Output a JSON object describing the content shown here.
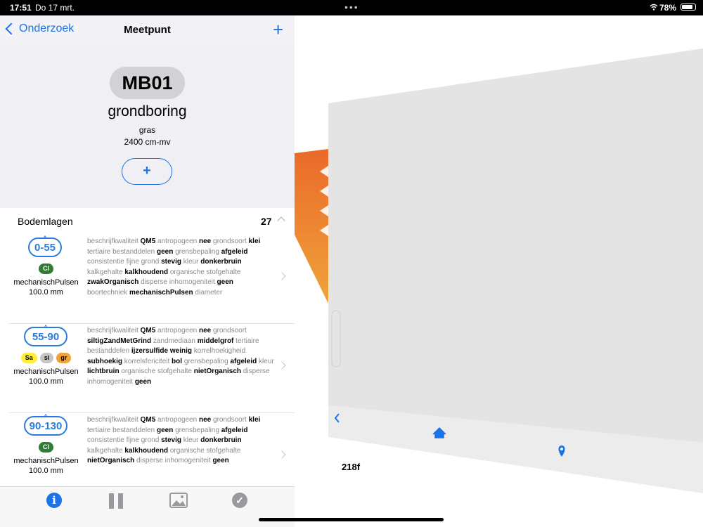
{
  "status_bar": {
    "time": "17:51",
    "date": "Do 17 mrt.",
    "battery": "78%"
  },
  "nav": {
    "back_label": "Onderzoek",
    "title": "Meetpunt"
  },
  "point": {
    "code": "MB01",
    "type": "grondboring",
    "surface": "gras",
    "depth": "2400 cm-mv",
    "add_label": "+"
  },
  "section": {
    "title": "Bodemlagen",
    "count": "27"
  },
  "layers": [
    {
      "range": "0-55",
      "tags": [
        {
          "label": "Cl",
          "color": "#2e7d32"
        }
      ],
      "method": "mechanischPulsen",
      "diameter": "100.0 mm",
      "properties": [
        [
          "beschrijfkwaliteit",
          "QM5"
        ],
        [
          "antropogeen",
          "nee"
        ],
        [
          "grondsoort",
          "klei"
        ],
        [
          "tertiaire bestanddelen",
          "geen"
        ],
        [
          "grensbepaling",
          "afgeleid"
        ],
        [
          "consistentie fijne grond",
          "stevig"
        ],
        [
          "kleur",
          "donkerbruin"
        ],
        [
          "kalkgehalte",
          "kalkhoudend"
        ],
        [
          "organische stofgehalte",
          "zwakOrganisch"
        ],
        [
          "disperse inhomogeniteit",
          "geen"
        ],
        [
          "boortechniek",
          "mechanischPulsen"
        ],
        [
          "diameter",
          ""
        ]
      ]
    },
    {
      "range": "55-90",
      "tags": [
        {
          "label": "Sa",
          "color": "#ffee3a"
        },
        {
          "label": "si",
          "color": "#c6c6c6"
        },
        {
          "label": "gr",
          "color": "#f0a23a"
        }
      ],
      "method": "mechanischPulsen",
      "diameter": "100.0 mm",
      "properties": [
        [
          "beschrijfkwaliteit",
          "QM5"
        ],
        [
          "antropogeen",
          "nee"
        ],
        [
          "grondsoort",
          "siltigZandMetGrind"
        ],
        [
          "zandmediaan",
          "middelgrof"
        ],
        [
          "tertiaire bestanddelen",
          "ijzersulfide weinig"
        ],
        [
          "korrelhoekigheid",
          "subhoekig"
        ],
        [
          "korrelsfericiteit",
          "bol"
        ],
        [
          "grensbepaling",
          "afgeleid"
        ],
        [
          "kleur",
          "lichtbruin"
        ],
        [
          "organische stofgehalte",
          "nietOrganisch"
        ],
        [
          "disperse inhomogeniteit",
          "geen"
        ]
      ]
    },
    {
      "range": "90-130",
      "tags": [
        {
          "label": "Cl",
          "color": "#2e7d32"
        }
      ],
      "method": "mechanischPulsen",
      "diameter": "100.0 mm",
      "properties": [
        [
          "beschrijfkwaliteit",
          "QM5"
        ],
        [
          "antropogeen",
          "nee"
        ],
        [
          "grondsoort",
          "klei"
        ],
        [
          "tertiaire bestanddelen",
          "geen"
        ],
        [
          "grensbepaling",
          "afgeleid"
        ],
        [
          "consistentie fijne grond",
          "stevig"
        ],
        [
          "kleur",
          "donkerbruin"
        ],
        [
          "kalkgehalte",
          "kalkhoudend"
        ],
        [
          "organische stofgehalte",
          "nietOrganisch"
        ],
        [
          "disperse inhomogeniteit",
          "geen"
        ]
      ]
    }
  ],
  "tabs": [
    "info-icon",
    "pause-icon",
    "image-icon",
    "check-icon"
  ],
  "map": {
    "label": "218f"
  },
  "colors": {
    "accent": "#1a73e8",
    "depth_pill": "#2a7be0"
  }
}
